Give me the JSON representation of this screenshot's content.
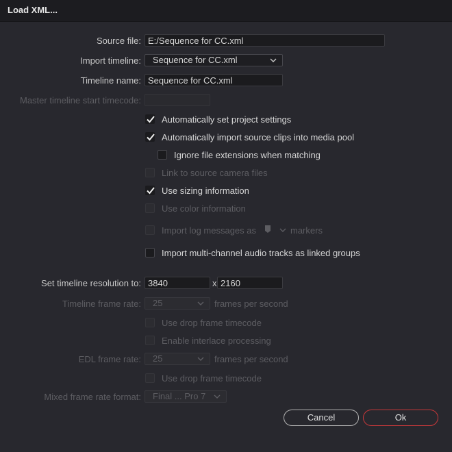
{
  "title": "Load XML...",
  "source_file": {
    "label": "Source file:",
    "value": "E:/Sequence for CC.xml"
  },
  "import_timeline": {
    "label": "Import timeline:",
    "value": "Sequence for CC.xml"
  },
  "timeline_name": {
    "label": "Timeline name:",
    "value": "Sequence for CC.xml"
  },
  "master_start": {
    "label": "Master timeline start timecode:",
    "value": ""
  },
  "checkboxes": {
    "auto_project": {
      "label": "Automatically set project settings",
      "checked": true,
      "enabled": true
    },
    "auto_import": {
      "label": "Automatically import source clips into media pool",
      "checked": true,
      "enabled": true
    },
    "ignore_ext": {
      "label": "Ignore file extensions when matching",
      "checked": false,
      "enabled": true
    },
    "link_camera": {
      "label": "Link to source camera files",
      "checked": false,
      "enabled": false
    },
    "sizing": {
      "label": "Use sizing information",
      "checked": true,
      "enabled": true
    },
    "color_info": {
      "label": "Use color information",
      "checked": false,
      "enabled": false
    },
    "log_messages": {
      "label": "Import log messages as",
      "suffix": "markers",
      "checked": false,
      "enabled": false
    },
    "multichannel": {
      "label": "Import multi-channel audio tracks as linked groups",
      "checked": false,
      "enabled": true
    },
    "drop_frame_1": {
      "label": "Use drop frame timecode",
      "checked": false,
      "enabled": false
    },
    "interlace": {
      "label": "Enable interlace processing",
      "checked": false,
      "enabled": false
    },
    "drop_frame_2": {
      "label": "Use drop frame timecode",
      "checked": false,
      "enabled": false
    }
  },
  "resolution": {
    "label": "Set timeline resolution to:",
    "width": "3840",
    "separator": "x",
    "height": "2160"
  },
  "frame_rate": {
    "label": "Timeline frame rate:",
    "value": "25",
    "unit": "frames per second"
  },
  "edl_rate": {
    "label": "EDL frame rate:",
    "value": "25",
    "unit": "frames per second"
  },
  "mixed_format": {
    "label": "Mixed frame rate format:",
    "value": "Final ... Pro 7"
  },
  "buttons": {
    "cancel": "Cancel",
    "ok": "Ok"
  },
  "colors": {
    "background": "#28282e",
    "titlebar": "#1c1c20",
    "ok_border": "#c8383a",
    "disabled_text": "#5d5d62"
  }
}
